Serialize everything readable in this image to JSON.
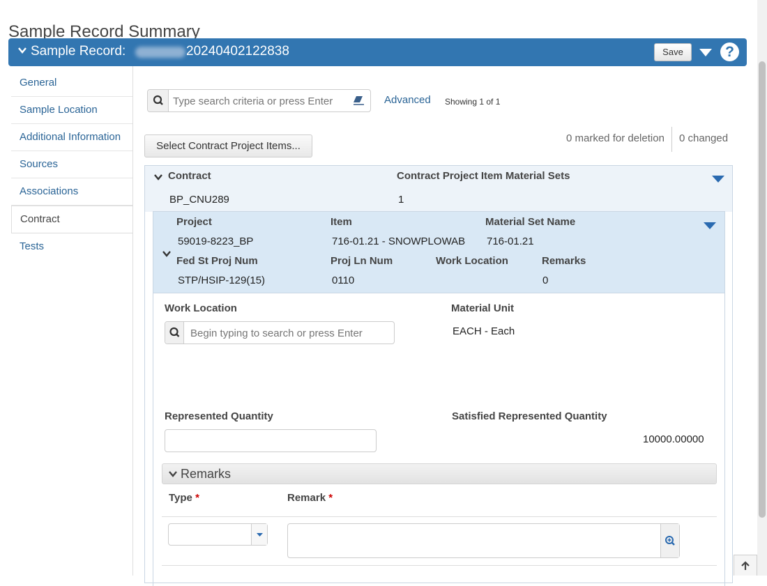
{
  "page": {
    "title": "Sample Record Summary"
  },
  "record_bar": {
    "label": "Sample Record:",
    "record_id": "20240402122838",
    "save_label": "Save",
    "help_glyph": "?"
  },
  "sidebar": {
    "items": [
      {
        "label": "General"
      },
      {
        "label": "Sample Location"
      },
      {
        "label": "Additional Information"
      },
      {
        "label": "Sources"
      },
      {
        "label": "Associations"
      },
      {
        "label": "Contract",
        "active": true
      },
      {
        "label": "Tests"
      }
    ]
  },
  "toolbar": {
    "search_placeholder": "Type search criteria or press Enter",
    "advanced_label": "Advanced",
    "showing_text": "Showing 1 of 1",
    "select_items_label": "Select Contract Project Items...",
    "marked_for_deletion": "0 marked for deletion",
    "changed": "0 changed"
  },
  "contract": {
    "contract_label": "Contract",
    "contract_value": "BP_CNU289",
    "material_sets_label": "Contract Project Item Material Sets",
    "material_sets_value": "1"
  },
  "item": {
    "project_label": "Project",
    "project_value": "59019-8223_BP",
    "item_label": "Item",
    "item_value": "716-01.21 - SNOWPLOWAB",
    "material_set_name_label": "Material Set Name",
    "material_set_name_value": "716-01.21",
    "fed_st_proj_num_label": "Fed St Proj Num",
    "fed_st_proj_num_value": "STP/HSIP-129(15)",
    "proj_ln_num_label": "Proj Ln Num",
    "proj_ln_num_value": "0110",
    "work_location_label": "Work Location",
    "remarks_label": "Remarks",
    "remarks_value": "0"
  },
  "detail": {
    "work_location_label": "Work Location",
    "work_location_placeholder": "Begin typing to search or press Enter",
    "material_unit_label": "Material Unit",
    "material_unit_value": "EACH - Each",
    "represented_quantity_label": "Represented Quantity",
    "represented_quantity_value": "",
    "satisfied_label": "Satisfied Represented Quantity",
    "satisfied_value": "10000.00000",
    "remarks_section_title": "Remarks",
    "type_label": "Type",
    "remark_label": "Remark",
    "required_marker": "*"
  },
  "colors": {
    "accent": "#3276b1",
    "link": "#2a6496",
    "required": "#cc0000",
    "header_row_bg": "#edf3f9",
    "item_row_bg": "#d9e8f5"
  },
  "icons": [
    "chevron-down-icon",
    "caret-down-icon",
    "help-icon",
    "search-icon",
    "eraser-icon",
    "zoom-in-icon",
    "arrow-up-icon"
  ]
}
